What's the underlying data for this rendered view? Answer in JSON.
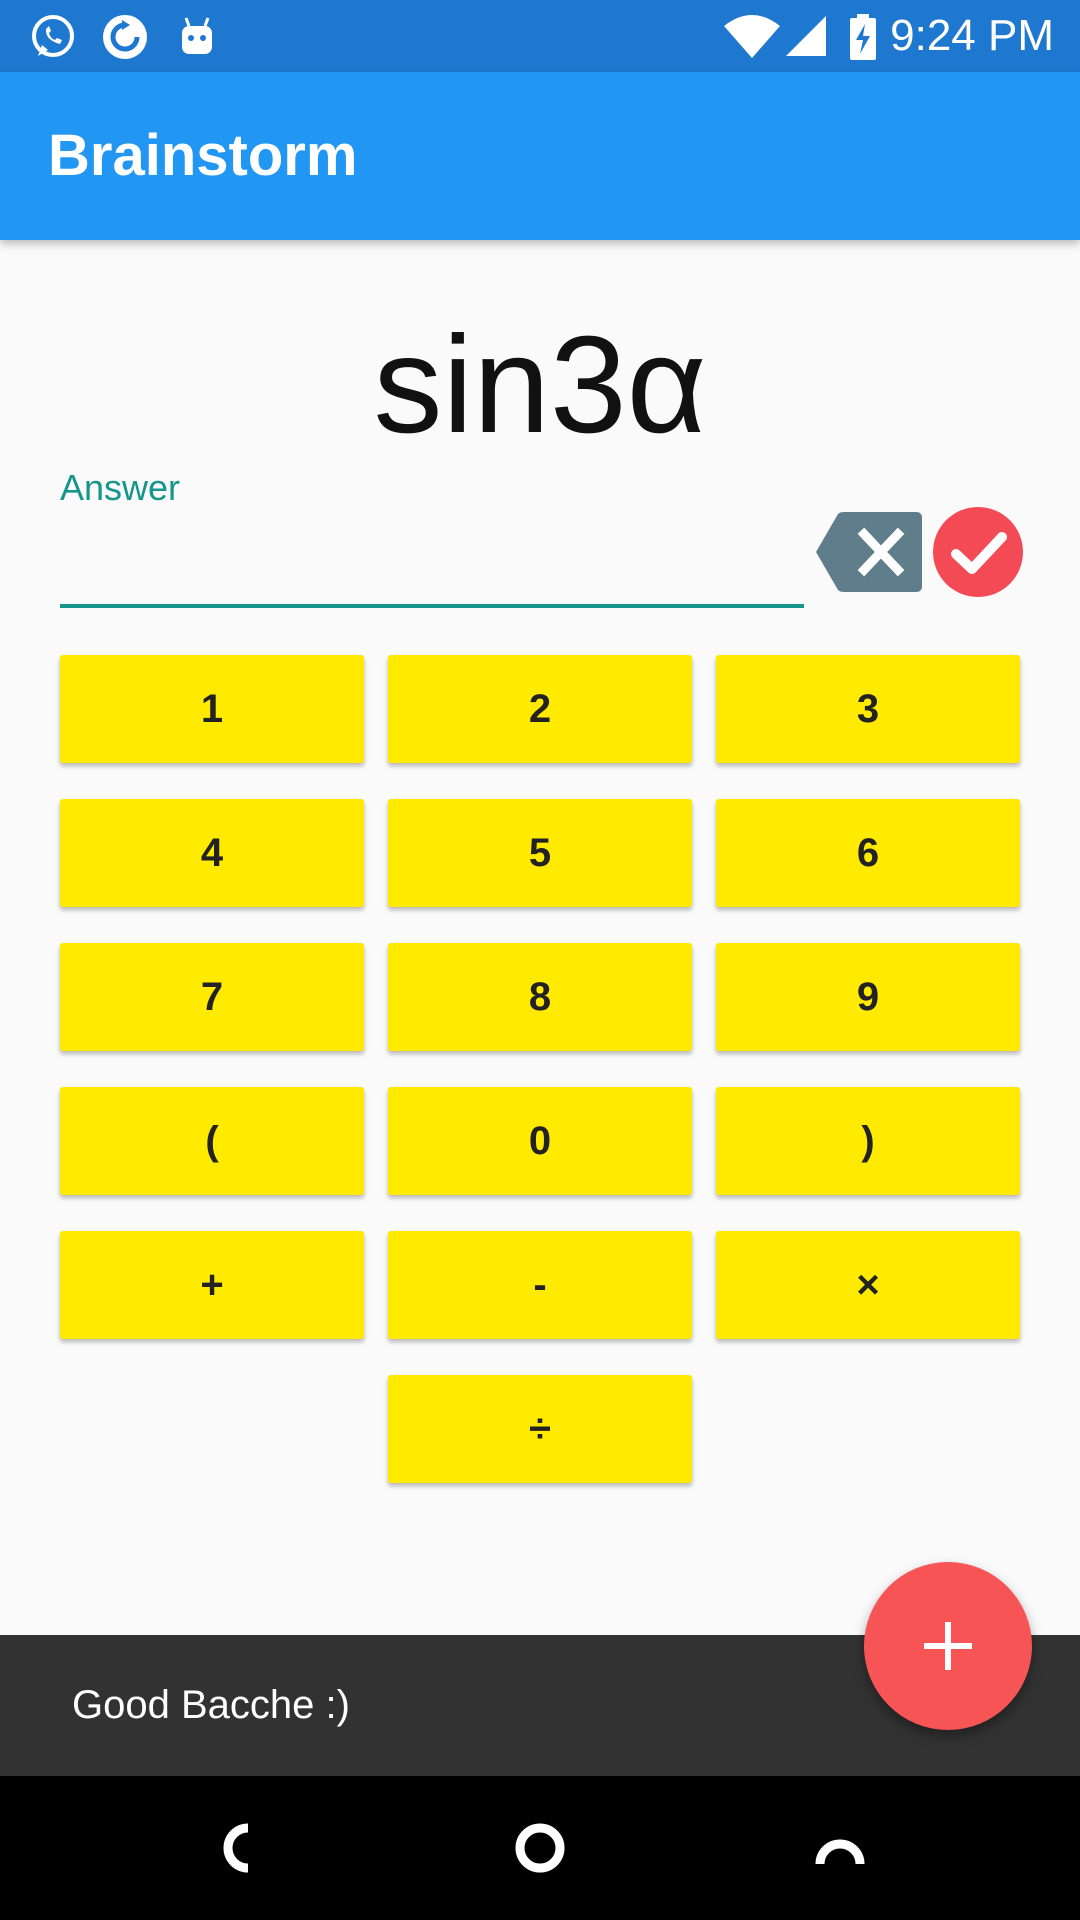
{
  "status_bar": {
    "time": "9:24 PM",
    "icons": [
      "whatsapp-icon",
      "sync-icon",
      "android-icon",
      "wifi-icon",
      "signal-icon",
      "battery-charging-icon"
    ]
  },
  "app_bar": {
    "title": "Brainstorm",
    "color": "#2196f3"
  },
  "question": {
    "text": "sin3α"
  },
  "answer": {
    "label": "Answer",
    "value": "",
    "accent": "#16968a"
  },
  "keypad": {
    "color": "#ffea00",
    "rows": [
      [
        "1",
        "2",
        "3"
      ],
      [
        "4",
        "5",
        "6"
      ],
      [
        "7",
        "8",
        "9"
      ],
      [
        "(",
        "0",
        ")"
      ],
      [
        "+",
        "-",
        "×"
      ],
      [
        "÷"
      ]
    ]
  },
  "snackbar": {
    "text": "Good Bacche :)"
  },
  "fab": {
    "icon": "plus-icon",
    "color": "#f75555"
  },
  "nav_bar": {
    "buttons": [
      "back-icon",
      "home-icon",
      "recents-icon"
    ]
  }
}
